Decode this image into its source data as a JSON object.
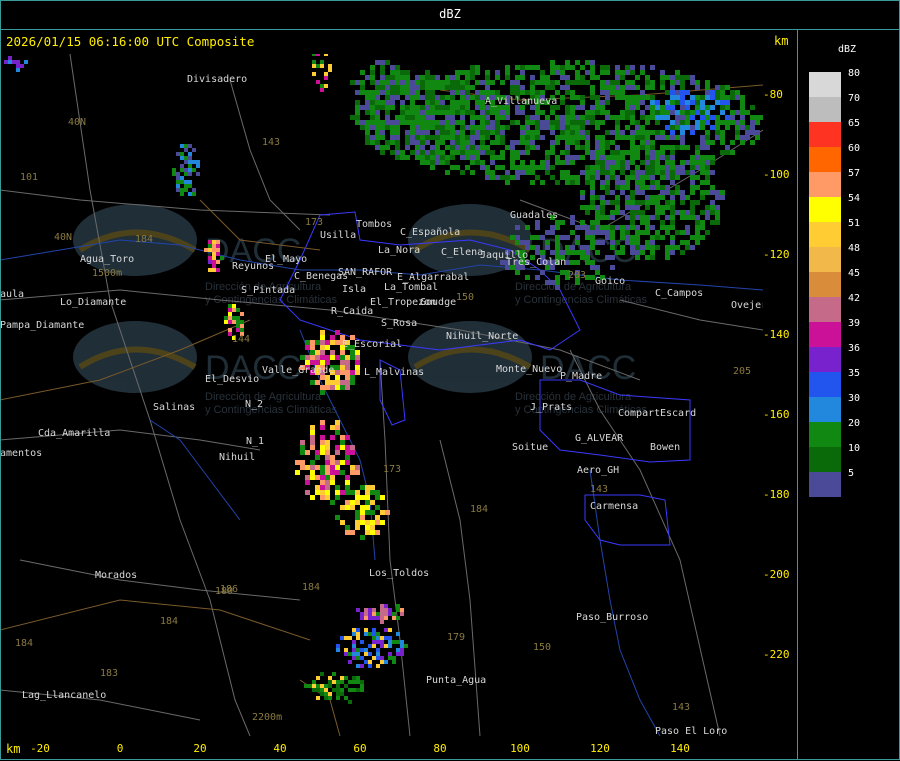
{
  "header": {
    "title": "dBZ",
    "timestamp_line": "2026/01/15 06:16:00 UTC Composite",
    "km_top": "km",
    "km_bottom": "km"
  },
  "axes": {
    "x_ticks": [
      "-20",
      "0",
      "20",
      "40",
      "60",
      "80",
      "100",
      "120",
      "140"
    ],
    "y_ticks": [
      "-80",
      "-100",
      "-120",
      "-140",
      "-160",
      "-180",
      "-200",
      "-220"
    ]
  },
  "legend": {
    "title": "dBZ",
    "entries": [
      {
        "label": "80",
        "color": "#d8d8d8"
      },
      {
        "label": "70",
        "color": "#bdbdbd"
      },
      {
        "label": "65",
        "color": "#ff3322"
      },
      {
        "label": "60",
        "color": "#ff6600"
      },
      {
        "label": "57",
        "color": "#ff9966"
      },
      {
        "label": "54",
        "color": "#ffff00"
      },
      {
        "label": "51",
        "color": "#ffcc33"
      },
      {
        "label": "48",
        "color": "#f2b84a"
      },
      {
        "label": "45",
        "color": "#d98c3a"
      },
      {
        "label": "42",
        "color": "#c66a8a"
      },
      {
        "label": "39",
        "color": "#cc1199"
      },
      {
        "label": "36",
        "color": "#7722cc"
      },
      {
        "label": "35",
        "color": "#2255ee"
      },
      {
        "label": "30",
        "color": "#2288dd"
      },
      {
        "label": "20",
        "color": "#118811"
      },
      {
        "label": "10",
        "color": "#0a6a0a"
      },
      {
        "label": "5",
        "color": "#4a4a99"
      }
    ]
  },
  "places": [
    {
      "name": "Divisadero"
    },
    {
      "name": "A_Villanueva"
    },
    {
      "name": "Guadales"
    },
    {
      "name": "Tombos"
    },
    {
      "name": "Usilla"
    },
    {
      "name": "C_Española"
    },
    {
      "name": "C_Elena"
    },
    {
      "name": "Jaquillo"
    },
    {
      "name": "Tres_Colan"
    },
    {
      "name": "La_Nora"
    },
    {
      "name": "Agua_Toro"
    },
    {
      "name": "Reyunos"
    },
    {
      "name": "El_Mayo"
    },
    {
      "name": "C_Benegas"
    },
    {
      "name": "SAN_RAFOR"
    },
    {
      "name": "E_Algarrabal"
    },
    {
      "name": "S_Pintada"
    },
    {
      "name": "Isla"
    },
    {
      "name": "La_Tombal"
    },
    {
      "name": "Goico"
    },
    {
      "name": "C_Campos"
    },
    {
      "name": "Ovejería"
    },
    {
      "name": "Pampa_Diamante"
    },
    {
      "name": "Lo_Diamante"
    },
    {
      "name": "R_Caida"
    },
    {
      "name": "El_Tropezon"
    },
    {
      "name": "Goudge"
    },
    {
      "name": "S_Rosa"
    },
    {
      "name": "Nihuil_Norte"
    },
    {
      "name": "E_Escorial"
    },
    {
      "name": "Valle_Grande"
    },
    {
      "name": "L_Malvinas"
    },
    {
      "name": "Monte_Nuevo"
    },
    {
      "name": "P_Madre"
    },
    {
      "name": "El_Desvio"
    },
    {
      "name": "Salinas"
    },
    {
      "name": "N_2"
    },
    {
      "name": "J_Prats"
    },
    {
      "name": "Compart"
    },
    {
      "name": "Escard"
    },
    {
      "name": "Cda_Amarilla"
    },
    {
      "name": "N_1"
    },
    {
      "name": "Soitue"
    },
    {
      "name": "G_ALVEAR"
    },
    {
      "name": "Bowen"
    },
    {
      "name": "Nihuil"
    },
    {
      "name": "Aero_GH"
    },
    {
      "name": "Carmensa"
    },
    {
      "name": "Morados"
    },
    {
      "name": "Los_Toldos"
    },
    {
      "name": "Paso_Burroso"
    },
    {
      "name": "Lag_Llancanelo"
    },
    {
      "name": "Punta_Agua"
    },
    {
      "name": "Paso_El_Loro"
    },
    {
      "name": "aula"
    },
    {
      "name": "amentos"
    }
  ],
  "route_labels": [
    "143",
    "101",
    "40N",
    "40N",
    "173",
    "150",
    "203",
    "205",
    "144",
    "173",
    "184",
    "186",
    "184",
    "180",
    "184",
    "183",
    "184",
    "179",
    "150",
    "143",
    "143",
    "1500m",
    "2200m",
    "184"
  ],
  "watermark": {
    "brand": "DACC",
    "subtitle_1": "Dirección de Agricultura",
    "subtitle_2": "y Contingencias Climáticas"
  }
}
